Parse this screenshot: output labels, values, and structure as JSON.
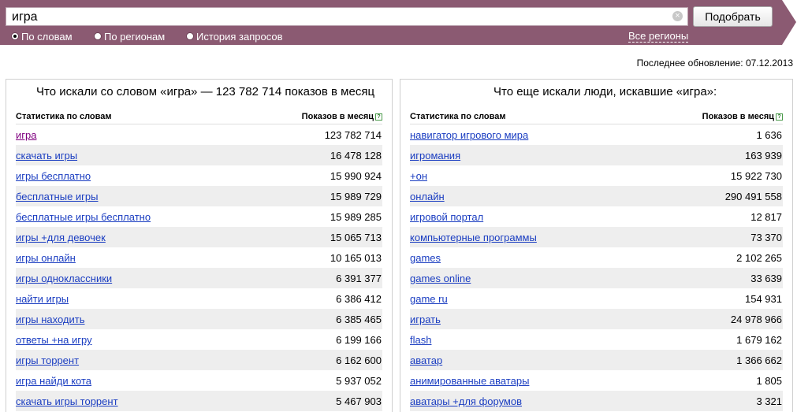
{
  "search": {
    "query": "игра",
    "submit_label": "Подобрать",
    "clear_glyph": "×",
    "modes": [
      {
        "label": "По словам",
        "selected": true
      },
      {
        "label": "По регионам",
        "selected": false
      },
      {
        "label": "История запросов",
        "selected": false
      }
    ],
    "region_link": "Все регионы"
  },
  "last_update": "Последнее обновление: 07.12.2013",
  "left_panel": {
    "title": "Что искали со словом «игра» — 123 782 714 показов в месяц",
    "col_keyword": "Статистика по словам",
    "col_count": "Показов в месяц",
    "help_glyph": "?",
    "rows": [
      {
        "keyword": "игра",
        "count": "123 782 714"
      },
      {
        "keyword": "скачать игры",
        "count": "16 478 128"
      },
      {
        "keyword": "игры бесплатно",
        "count": "15 990 924"
      },
      {
        "keyword": "бесплатные игры",
        "count": "15 989 729"
      },
      {
        "keyword": "бесплатные игры бесплатно",
        "count": "15 989 285"
      },
      {
        "keyword": "игры +для девочек",
        "count": "15 065 713"
      },
      {
        "keyword": "игры онлайн",
        "count": "10 165 013"
      },
      {
        "keyword": "игры одноклассники",
        "count": "6 391 377"
      },
      {
        "keyword": "найти игры",
        "count": "6 386 412"
      },
      {
        "keyword": "игры находить",
        "count": "6 385 465"
      },
      {
        "keyword": "ответы +на игру",
        "count": "6 199 166"
      },
      {
        "keyword": "игры торрент",
        "count": "6 162 600"
      },
      {
        "keyword": "игра найди кота",
        "count": "5 937 052"
      },
      {
        "keyword": "скачать игры торрент",
        "count": "5 467 903"
      }
    ]
  },
  "right_panel": {
    "title": "Что еще искали люди, искавшие «игра»:",
    "col_keyword": "Статистика по словам",
    "col_count": "Показов в месяц",
    "help_glyph": "?",
    "rows": [
      {
        "keyword": "навигатор игрового мира",
        "count": "1 636"
      },
      {
        "keyword": "игромания",
        "count": "163 939"
      },
      {
        "keyword": "+он",
        "count": "15 922 730"
      },
      {
        "keyword": "онлайн",
        "count": "290 491 558"
      },
      {
        "keyword": "игровой портал",
        "count": "12 817"
      },
      {
        "keyword": "компьютерные программы",
        "count": "73 370"
      },
      {
        "keyword": "games",
        "count": "2 102 265"
      },
      {
        "keyword": "games online",
        "count": "33 639"
      },
      {
        "keyword": "game ru",
        "count": "154 931"
      },
      {
        "keyword": "играть",
        "count": "24 978 966"
      },
      {
        "keyword": "flash",
        "count": "1 679 162"
      },
      {
        "keyword": "аватар",
        "count": "1 366 662"
      },
      {
        "keyword": "анимированные аватары",
        "count": "1 805"
      },
      {
        "keyword": "аватары +для форумов",
        "count": "3 321"
      }
    ]
  },
  "colors": {
    "band": "#8b5a72",
    "link": "#1a3dc1",
    "visited_link": "#800080",
    "row_stripe": "#eeeeee"
  }
}
